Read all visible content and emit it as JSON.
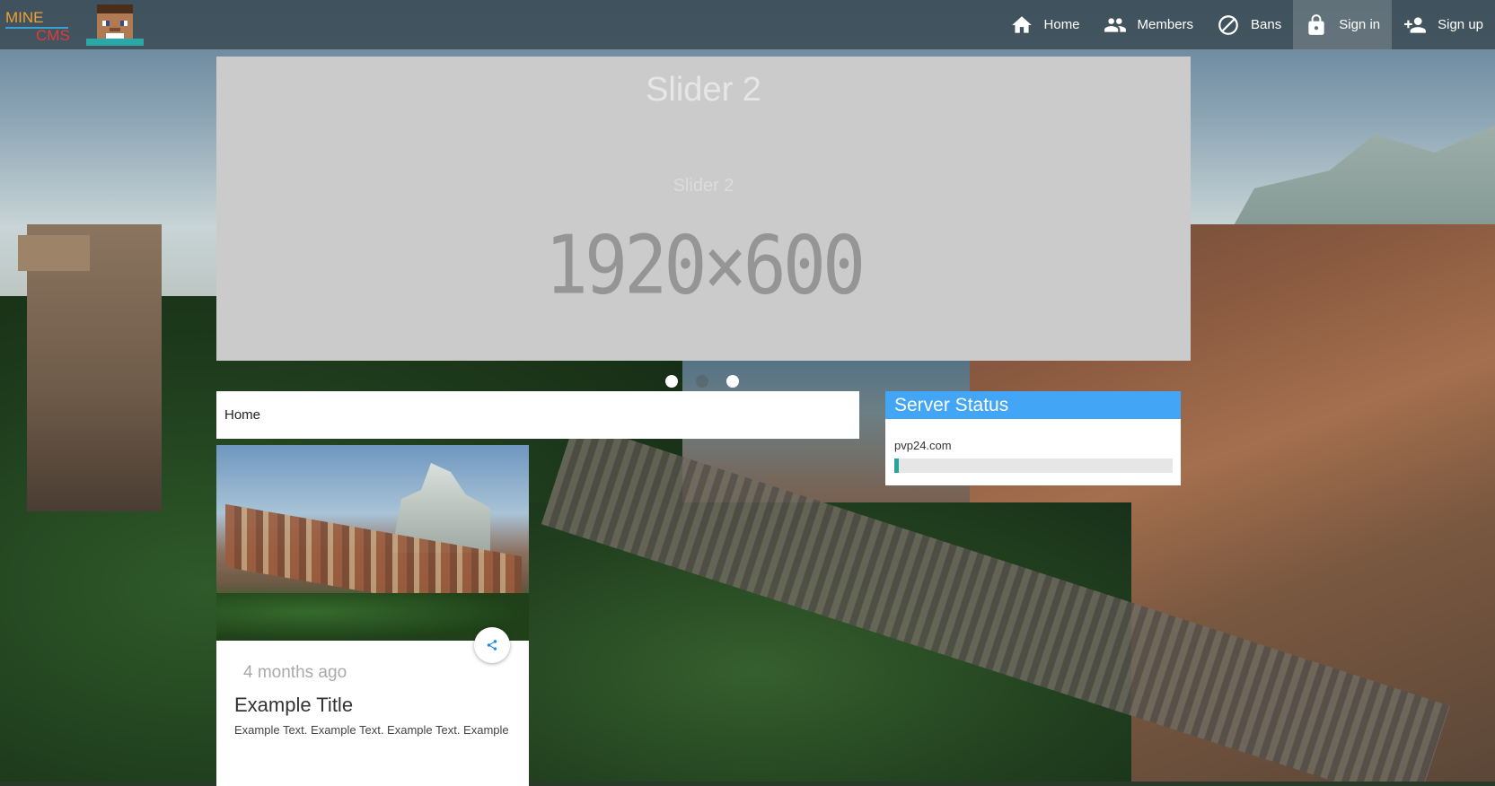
{
  "brand": {
    "logo_line1": "MINE",
    "logo_line2": "CMS",
    "logo_icon": "steve-avatar-icon"
  },
  "nav": [
    {
      "label": "Home",
      "icon": "home-icon"
    },
    {
      "label": "Members",
      "icon": "members-icon"
    },
    {
      "label": "Bans",
      "icon": "ban-icon"
    },
    {
      "label": "Sign in",
      "icon": "lock-icon",
      "active": true
    },
    {
      "label": "Sign up",
      "icon": "add-user-icon"
    }
  ],
  "slider": {
    "title": "Slider 2",
    "subtitle": "Slider 2",
    "placeholder": "1920×600",
    "dots": 3,
    "active_dot": 2
  },
  "breadcrumb": {
    "current": "Home"
  },
  "post": {
    "date": "4 months ago",
    "title": "Example Title",
    "text": "Example Text. Example Text. Example Text. Example",
    "share_icon": "share-icon"
  },
  "server_status": {
    "title": "Server Status",
    "host": "pvp24.com",
    "fill_fraction": 0.015,
    "fill_color": "#26a69a",
    "header_color": "#42a5f5"
  }
}
